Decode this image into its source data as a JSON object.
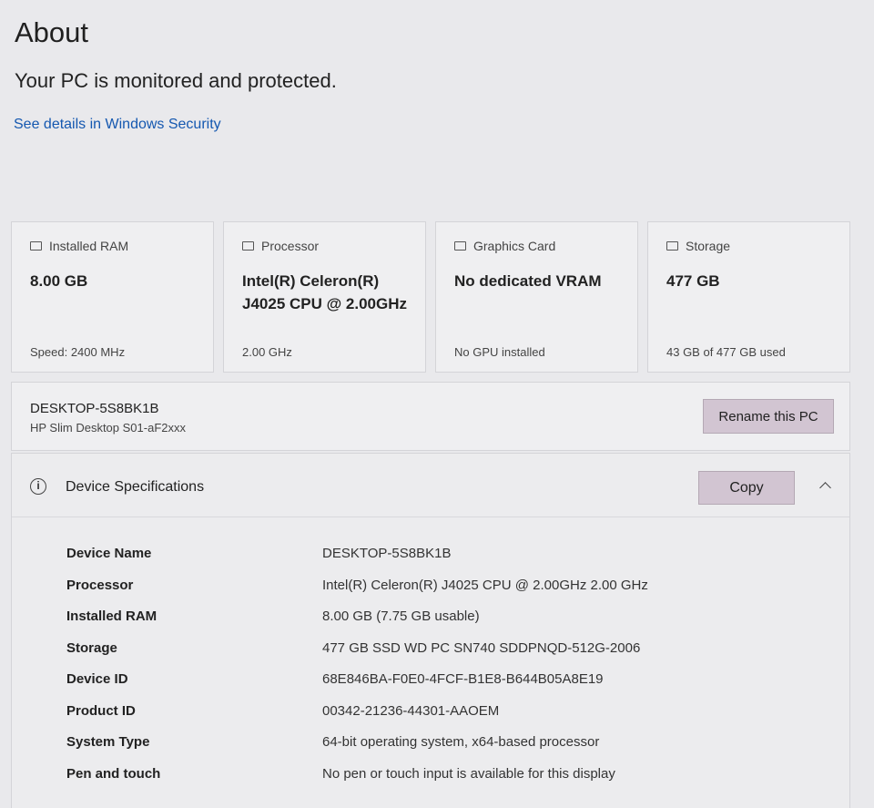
{
  "page": {
    "title": "About",
    "status": "Your PC is monitored and protected.",
    "security_link": "See details in Windows Security"
  },
  "cards": [
    {
      "icon": "ram-icon",
      "label": "Installed RAM",
      "value": "8.00 GB",
      "foot": "Speed: 2400 MHz"
    },
    {
      "icon": "processor-icon",
      "label": "Processor",
      "value": "Intel(R) Celeron(R) J4025 CPU @ 2.00GHz",
      "foot": "2.00 GHz"
    },
    {
      "icon": "graphics-card-icon",
      "label": "Graphics Card",
      "value": "No dedicated VRAM",
      "foot": "No GPU installed"
    },
    {
      "icon": "storage-icon",
      "label": "Storage",
      "value": "477 GB",
      "foot": "43 GB of 477 GB used"
    }
  ],
  "pc": {
    "name": "DESKTOP-5S8BK1B",
    "model": "HP Slim Desktop S01-aF2xxx",
    "rename_label": "Rename this PC"
  },
  "specs": {
    "title": "Device Specifications",
    "copy_label": "Copy",
    "rows": [
      {
        "label": "Device Name",
        "value": "DESKTOP-5S8BK1B"
      },
      {
        "label": "Processor",
        "value": "Intel(R) Celeron(R) J4025 CPU @ 2.00GHz   2.00 GHz"
      },
      {
        "label": "Installed RAM",
        "value": "8.00 GB (7.75 GB usable)"
      },
      {
        "label": "Storage",
        "value": "477 GB SSD WD PC SN740 SDDPNQD-512G-2006"
      },
      {
        "label": "Device ID",
        "value": "68E846BA-F0E0-4FCF-B1E8-B644B05A8E19"
      },
      {
        "label": "Product ID",
        "value": "00342-21236-44301-AAOEM"
      },
      {
        "label": "System Type",
        "value": "64-bit operating system, x64-based processor"
      },
      {
        "label": "Pen and touch",
        "value": "No pen or touch input is available for this display"
      }
    ]
  }
}
